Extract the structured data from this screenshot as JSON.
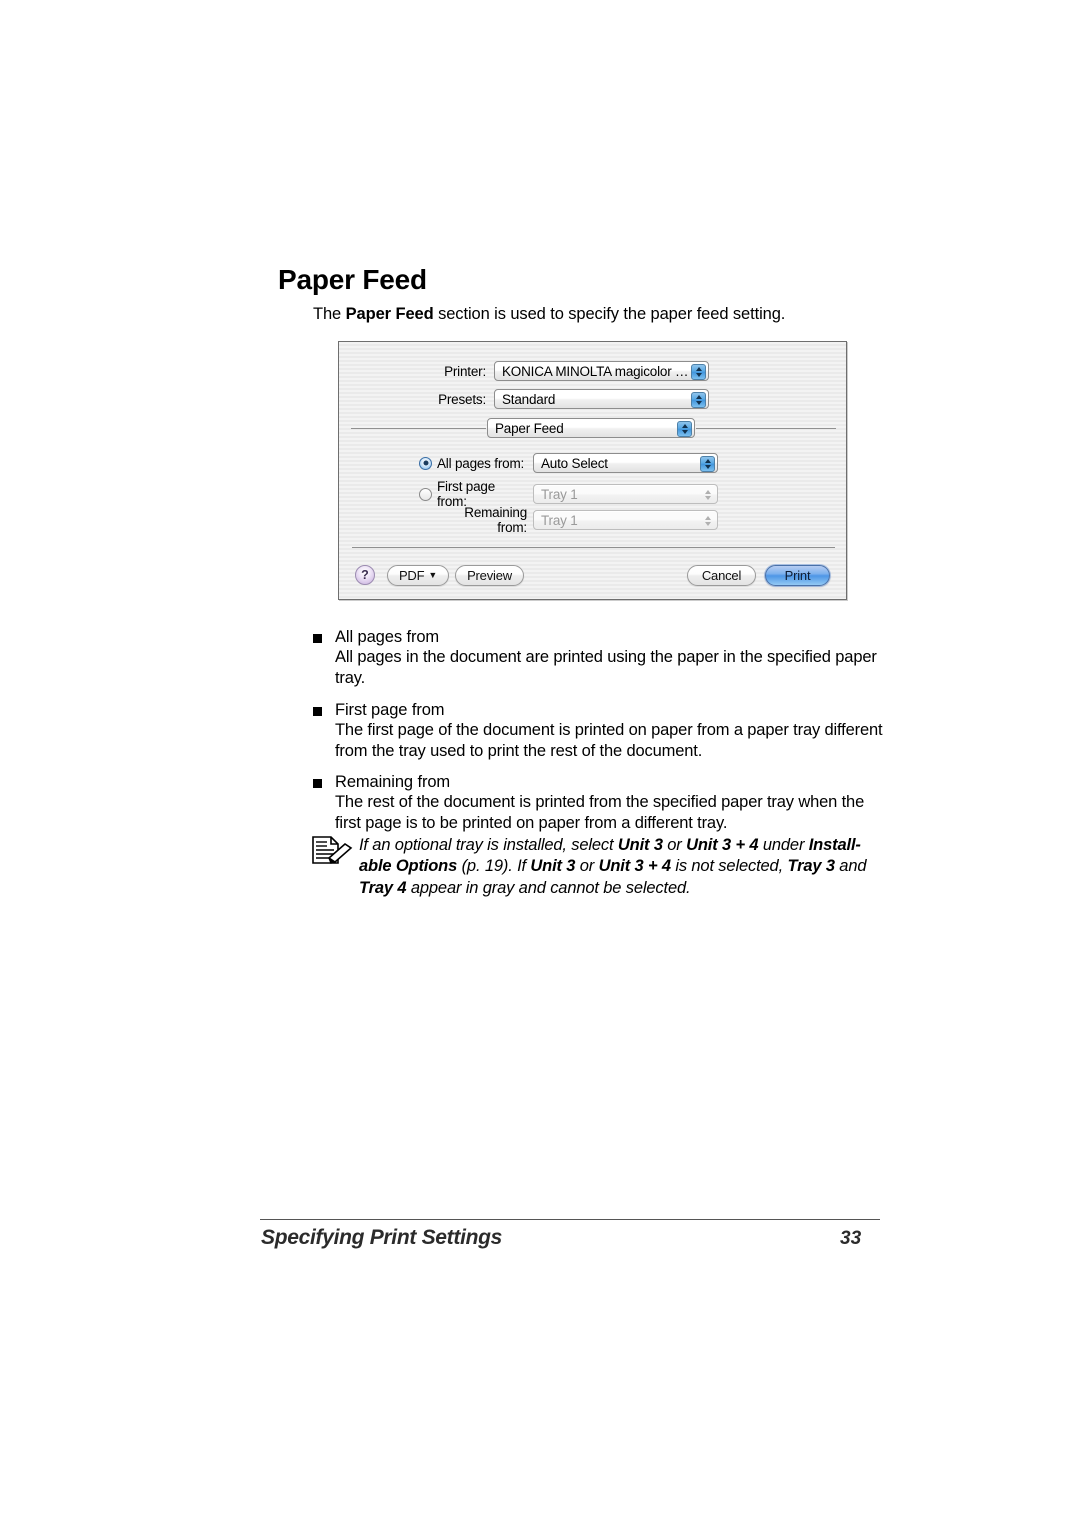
{
  "page": {
    "section_title": "Paper Feed",
    "intro_pre": "The ",
    "intro_bold": "Paper Feed",
    "intro_post": " section is used to specify the paper feed setting."
  },
  "dialog": {
    "name": "print-dialog",
    "rows": [
      {
        "label": "Printer:",
        "value": "KONICA MINOLTA magicolor …",
        "enabled": true
      },
      {
        "label": "Presets:",
        "value": "Standard",
        "enabled": true
      }
    ],
    "pane_popup": {
      "value": "Paper Feed",
      "enabled": true
    },
    "options": [
      {
        "label": "All pages from:",
        "value": "Auto Select",
        "radio": true,
        "selected": true,
        "enabled": true
      },
      {
        "label": "First page from:",
        "value": "Tray 1",
        "radio": true,
        "selected": false,
        "enabled": false
      },
      {
        "label": "Remaining from:",
        "value": "Tray 1",
        "radio": false,
        "selected": false,
        "enabled": false
      }
    ],
    "buttons": {
      "help": "?",
      "pdf": "PDF",
      "pdf_caret": "▼",
      "preview": "Preview",
      "cancel": "Cancel",
      "print": "Print"
    },
    "accent_color": "#4e96e6",
    "help_color": "#c9b3e0"
  },
  "bullets": [
    {
      "head": "All pages from",
      "body": "All pages in the document are printed using the paper in the specified paper tray."
    },
    {
      "head": "First page from",
      "body": "The first page of the document is printed on paper from a paper tray different from the tray used to print the rest of the document."
    },
    {
      "head": "Remaining from",
      "body": "The rest of the document is printed from the specified paper tray when the first page is to be printed on paper from a different tray."
    }
  ],
  "note": {
    "icon": "memo-note-icon",
    "segments": [
      {
        "text": "If an optional tray is installed, select ",
        "bold": false
      },
      {
        "text": "Unit 3",
        "bold": true
      },
      {
        "text": " or ",
        "bold": false
      },
      {
        "text": "Unit 3 + 4",
        "bold": true
      },
      {
        "text": " under ",
        "bold": false
      },
      {
        "text": "Install-able Options",
        "bold": true
      },
      {
        "text": " (p. 19). If ",
        "bold": false
      },
      {
        "text": "Unit 3",
        "bold": true
      },
      {
        "text": " or ",
        "bold": false
      },
      {
        "text": "Unit 3 + 4",
        "bold": true
      },
      {
        "text": " is not selected, ",
        "bold": false
      },
      {
        "text": "Tray 3",
        "bold": true
      },
      {
        "text": " and ",
        "bold": false
      },
      {
        "text": "Tray 4",
        "bold": true
      },
      {
        "text": " appear in gray and cannot be selected.",
        "bold": false
      }
    ]
  },
  "footer": {
    "title": "Specifying Print Settings",
    "page_number": "33"
  }
}
